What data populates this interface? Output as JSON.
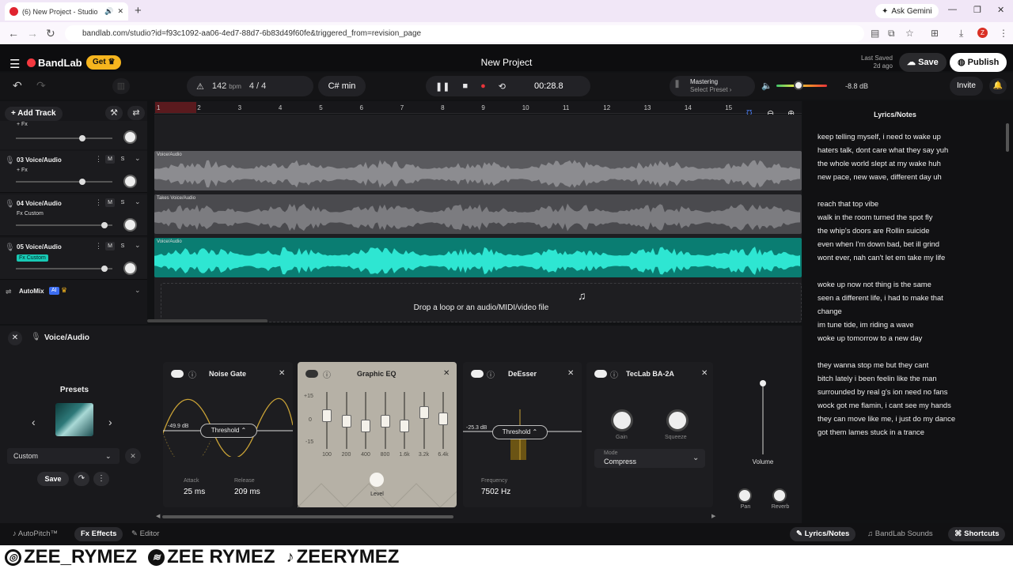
{
  "browser": {
    "tab_title": "(6) New Project - Studio",
    "new_tab": "+",
    "ask_gemini": "Ask Gemini",
    "url": "bandlab.com/studio?id=f93c1092-aa06-4ed7-88d7-6b83d49f60fe&triggered_from=revision_page",
    "profile_badge": "Z"
  },
  "header": {
    "logo": "BandLab",
    "get_label": "Get",
    "project_title": "New Project",
    "last_saved_label": "Last Saved",
    "last_saved_value": "2d ago",
    "save_label": "Save",
    "publish_label": "Publish"
  },
  "transport": {
    "bpm": "142",
    "bpm_unit": "bpm",
    "time_sig": "4 / 4",
    "key": "C# min",
    "time": "00:28.8",
    "mastering_label": "Mastering",
    "mastering_preset": "Select Preset",
    "master_volume": "-8.8 dB",
    "master_volume_level": 0.45,
    "invite_label": "Invite"
  },
  "tracks_panel": {
    "add_track": "Add Track",
    "top_fx": "+ Fx",
    "tracks": [
      {
        "num_name": "03  Voice/Audio",
        "fx": "+ Fx",
        "fx_highlight": false,
        "mute": "M",
        "solo": "S",
        "vol": 0.7
      },
      {
        "num_name": "04  Voice/Audio",
        "fx": "Fx Custom",
        "fx_highlight": false,
        "mute": "M",
        "solo": "S",
        "vol": 0.95
      },
      {
        "num_name": "05  Voice/Audio",
        "fx": "Fx Custom",
        "fx_highlight": true,
        "mute": "M",
        "solo": "S",
        "vol": 0.95
      }
    ],
    "automix": "AutoMix",
    "ai_badge": "AI"
  },
  "timeline": {
    "ruler": [
      "1",
      "2",
      "3",
      "4",
      "5",
      "6",
      "7",
      "8",
      "9",
      "10",
      "11",
      "12",
      "13",
      "14",
      "15"
    ],
    "lanes": [
      {
        "label": "Voice/Audio",
        "color": "#5a5a5e",
        "wave": "#8c8c90"
      },
      {
        "label": "Takes  Voice/Audio",
        "color": "#4a4a4e",
        "wave": "#7c7c80"
      },
      {
        "label": "Voice/Audio",
        "color": "#0a7d72",
        "wave": "#2ee6d2"
      }
    ],
    "drop_text": "Drop a loop or an audio/MIDI/video file"
  },
  "lyrics": {
    "title": "Lyrics/Notes",
    "text": "keep telling myself, i need to wake up\nhaters talk, dont care what they say yuh\nthe whole world slept at my wake huh\nnew pace, new wave, different day uh\n\nreach that top vibe\nwalk in the room turned the spot fly\nthe whip's doors are Rollin suicide\neven when I'm down bad, bet ill grind\nwont ever, nah can't let em take my life\n\nwoke up now not thing is the same\nseen a different life, i had to make that\nchange\nim tune tide, im riding a wave\nwoke up tomorrow to a new day\n\nthey wanna stop me but they cant\nbitch lately i been feelin like the man\nsurrounded by real g's ion need no fans\nwock got me flamin, i cant see my hands\nthey can move like me, i just do my dance\ngot them lames stuck in a trance"
  },
  "editor": {
    "track_title": "Voice/Audio",
    "presets_label": "Presets",
    "preset_value": "Custom",
    "preset_save": "Save",
    "noise_gate": {
      "title": "Noise Gate",
      "db": "-49.9 dB",
      "threshold": "Threshold",
      "attack_label": "Attack",
      "attack": "25 ms",
      "release_label": "Release",
      "release": "209 ms"
    },
    "graphic_eq": {
      "title": "Graphic EQ",
      "scale": [
        "+15",
        "0",
        "-15"
      ],
      "bands": [
        "100",
        "200",
        "400",
        "800",
        "1.6k",
        "3.2k",
        "6.4k"
      ],
      "band_levels": [
        0.65,
        0.55,
        0.45,
        0.55,
        0.45,
        0.72,
        0.6
      ],
      "level_label": "Level"
    },
    "deesser": {
      "title": "DeEsser",
      "db": "-25.3 dB",
      "threshold": "Threshold",
      "freq_label": "Frequency",
      "freq": "7502 Hz"
    },
    "teclab": {
      "title": "TecLab BA-2A",
      "gain_label": "Gain",
      "squeeze_label": "Squeeze",
      "mode_label": "Mode",
      "mode": "Compress"
    },
    "volume_label": "Volume",
    "volume_level": 0.95,
    "pan_label": "Pan",
    "reverb_label": "Reverb"
  },
  "footer": {
    "autopitch": "AutoPitch™",
    "effects": "Effects",
    "editor": "Editor",
    "lyrics_notes": "Lyrics/Notes",
    "bandlab_sounds": "BandLab Sounds",
    "shortcuts": "Shortcuts"
  },
  "social": {
    "instagram": "ZEE_RYMEZ",
    "spotify": "ZEE RYMEZ",
    "tiktok": "ZEERYMEZ"
  }
}
